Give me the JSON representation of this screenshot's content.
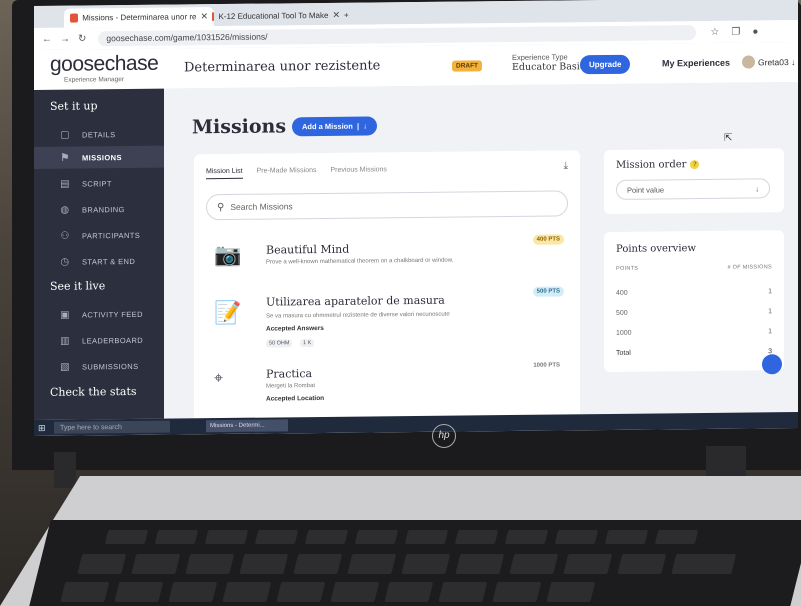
{
  "browser": {
    "tabs": [
      {
        "label": "Missions - Determinarea unor re"
      },
      {
        "label": "K-12 Educational Tool To Make"
      }
    ],
    "new_tab": "+",
    "url": "goosechase.com/game/1031526/missions/"
  },
  "header": {
    "logo": "goosechase",
    "logo_sub": "Experience Manager",
    "game_title": "Determinarea unor rezistente",
    "draft_badge": "DRAFT",
    "experience_type_label": "Experience Type",
    "experience_type_value": "Educator Basic",
    "upgrade_label": "Upgrade",
    "my_experiences_label": "My Experiences",
    "user_name": "Greta03"
  },
  "sidebar": {
    "section_setup": "Set it up",
    "items_setup": [
      {
        "label": "DETAILS",
        "icon": "document-icon"
      },
      {
        "label": "MISSIONS",
        "icon": "flag-icon",
        "active": true
      },
      {
        "label": "SCRIPT",
        "icon": "script-icon"
      },
      {
        "label": "BRANDING",
        "icon": "palette-icon"
      },
      {
        "label": "PARTICIPANTS",
        "icon": "people-icon"
      },
      {
        "label": "START & END",
        "icon": "clock-icon"
      }
    ],
    "section_live": "See it live",
    "items_live": [
      {
        "label": "ACTIVITY FEED",
        "icon": "feed-icon"
      },
      {
        "label": "LEADERBOARD",
        "icon": "leaderboard-icon"
      },
      {
        "label": "SUBMISSIONS",
        "icon": "image-icon"
      }
    ],
    "section_stats": "Check the stats"
  },
  "main": {
    "title": "Missions",
    "add_button": "Add a Mission",
    "tabs": [
      "Mission List",
      "Pre-Made Missions",
      "Previous Missions"
    ],
    "search_placeholder": "Search Missions",
    "missions": [
      {
        "name": "Beautiful Mind",
        "description": "Prove a well-known mathematical theorem on a chalkboard or window.",
        "points": "400 PTS",
        "icon": "camera-icon"
      },
      {
        "name": "Utilizarea aparatelor de masura",
        "description": "Se va masura cu ohmmetrul rezistente de diverse valori necunoscute",
        "points": "500 PTS",
        "accepted": "Accepted Answers",
        "chips": [
          "50 OHM",
          "1 K"
        ],
        "icon": "notepad-icon"
      },
      {
        "name": "Practica",
        "description": "Mergeti la Rombat",
        "points": "1000 PTS",
        "accepted": "Accepted Location",
        "icon": "location-icon"
      }
    ]
  },
  "right": {
    "order_title": "Mission order",
    "order_value": "Point value",
    "points_title": "Points overview",
    "col_points": "POINTS",
    "col_missions": "# OF MISSIONS",
    "rows": [
      {
        "points": "400",
        "count": "1"
      },
      {
        "points": "500",
        "count": "1"
      },
      {
        "points": "1000",
        "count": "1"
      }
    ],
    "total_label": "Total",
    "total_value": "3"
  },
  "taskbar": {
    "search_placeholder": "Type here to search",
    "app_label": "Missions - Determi..."
  },
  "device": {
    "brand": "hp"
  },
  "colors": {
    "accent": "#2f66e0",
    "sidebar": "#2c2f3d",
    "draft": "#f3b23e"
  }
}
